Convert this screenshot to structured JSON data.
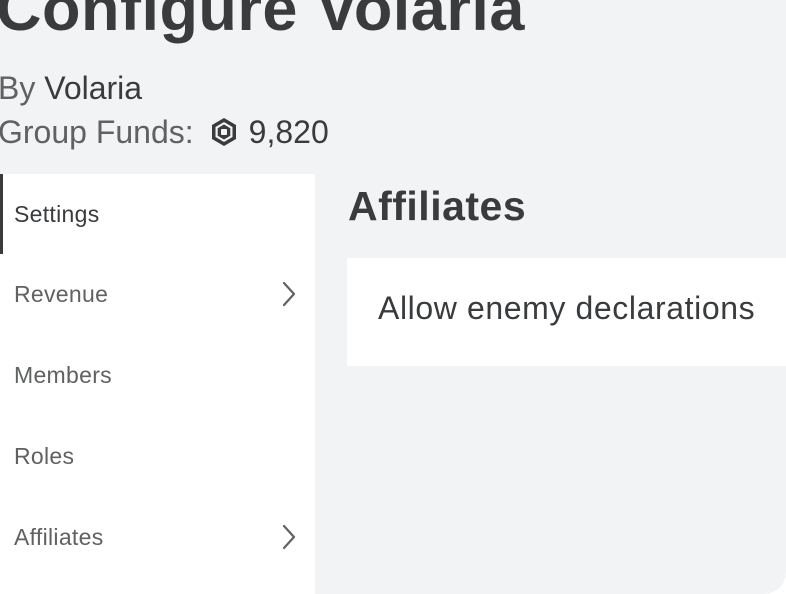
{
  "header": {
    "title": "Configure Volaria",
    "by_label": "By",
    "owner": "Volaria",
    "funds_label": "Group Funds:",
    "funds_icon": "robux-icon",
    "funds_amount": "9,820"
  },
  "sidebar": {
    "items": [
      {
        "label": "Settings",
        "active": true,
        "has_chevron": false
      },
      {
        "label": "Revenue",
        "active": false,
        "has_chevron": true
      },
      {
        "label": "Members",
        "active": false,
        "has_chevron": false
      },
      {
        "label": "Roles",
        "active": false,
        "has_chevron": false
      },
      {
        "label": "Affiliates",
        "active": false,
        "has_chevron": true
      }
    ]
  },
  "main": {
    "section_title": "Affiliates",
    "setting_label": "Allow enemy declarations"
  },
  "colors": {
    "background": "#f2f3f5",
    "panel": "#ffffff",
    "text_dark": "#393b3d",
    "text_muted": "#606162"
  }
}
